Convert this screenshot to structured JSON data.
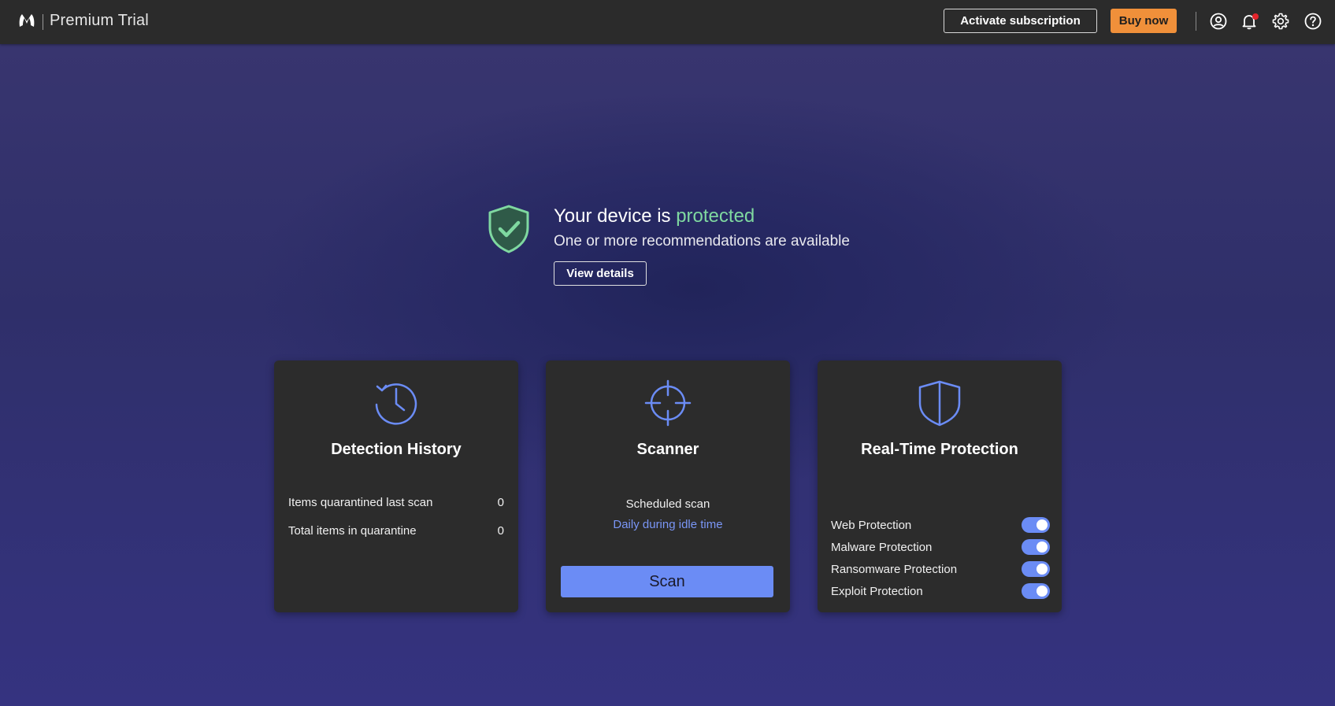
{
  "app": {
    "brand": "Premium Trial"
  },
  "header": {
    "activate_label": "Activate subscription",
    "buy_label": "Buy now",
    "icons": [
      "account-icon",
      "notification-bell-icon",
      "settings-gear-icon",
      "help-icon"
    ],
    "has_notification": true
  },
  "hero": {
    "title_prefix": "Your device is ",
    "title_status": "protected",
    "subtitle": "One or more recommendations are available",
    "details_label": "View details"
  },
  "cards": {
    "history": {
      "title": "Detection History",
      "stats": [
        {
          "label": "Items quarantined last scan",
          "value": "0"
        },
        {
          "label": "Total items in quarantine",
          "value": "0"
        }
      ]
    },
    "scanner": {
      "title": "Scanner",
      "schedule_label": "Scheduled scan",
      "schedule_value": "Daily during idle time",
      "scan_label": "Scan"
    },
    "realtime": {
      "title": "Real-Time Protection",
      "items": [
        {
          "label": "Web Protection",
          "enabled": true
        },
        {
          "label": "Malware Protection",
          "enabled": true
        },
        {
          "label": "Ransomware Protection",
          "enabled": true
        },
        {
          "label": "Exploit Protection",
          "enabled": true
        }
      ]
    }
  },
  "colors": {
    "accent": "#6b8cf5",
    "buy": "#f0903a",
    "protected": "#7fd8a0",
    "topbar": "#2b2b2b",
    "card": "#2c2c2c"
  }
}
